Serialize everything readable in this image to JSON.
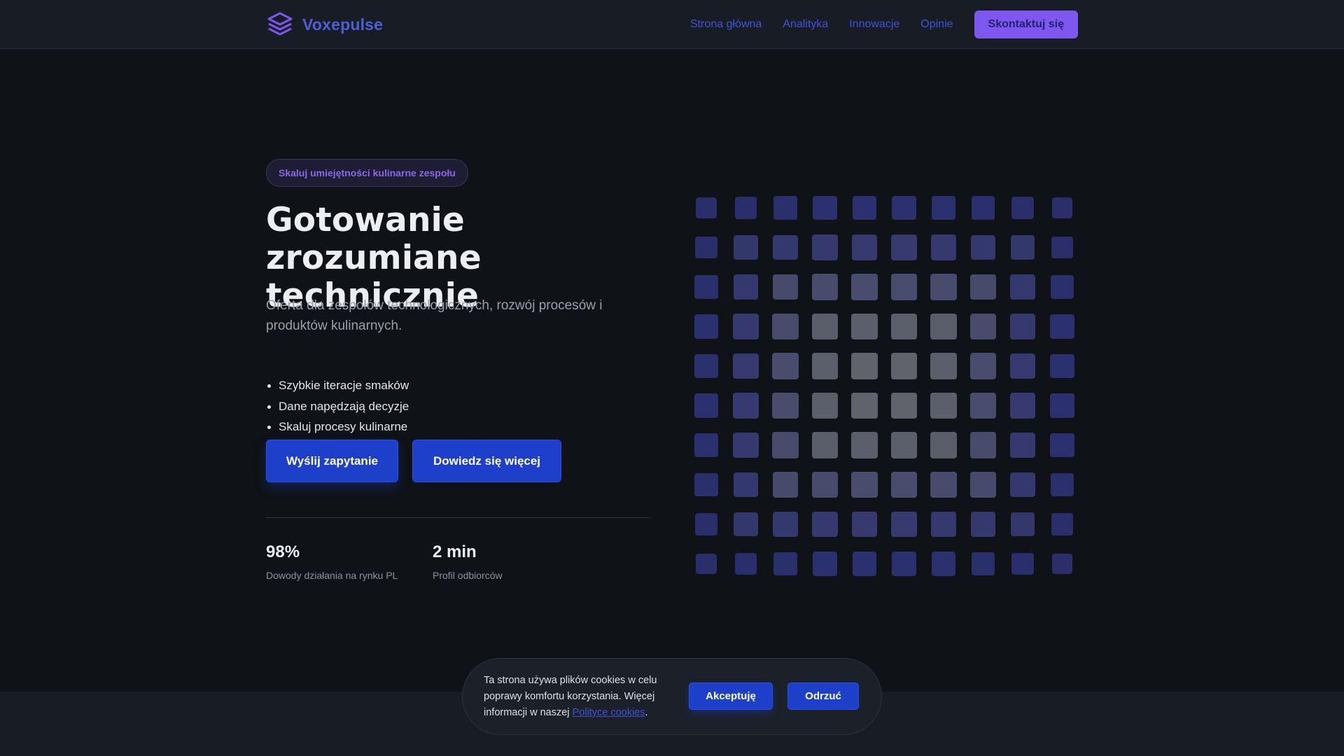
{
  "brand": {
    "name": "Voxepulse",
    "logo_icon": "layers-icon",
    "accent": "#4c5fd6"
  },
  "nav": {
    "items": [
      {
        "label": "Strona główna"
      },
      {
        "label": "Analityka"
      },
      {
        "label": "Innowacje"
      },
      {
        "label": "Opinie"
      }
    ],
    "cta_label": "Skontaktuj się"
  },
  "hero": {
    "badge": "Skaluj umiejętności kulinarne zespołu",
    "title": "Gotowanie zrozumiane technicznie",
    "subtitle": "Oferta dla zespołów technologicznych, rozwój procesów i produktów kulinarnych.",
    "features": [
      "Szybkie iteracje smaków",
      "Dane napędzają decyzje",
      "Skaluj procesy kulinarne"
    ],
    "primary_button": "Wyślij zapytanie",
    "secondary_button": "Dowiedz się więcej",
    "stats": [
      {
        "value": "98%",
        "label": "Dowody działania na rynku PL"
      },
      {
        "value": "2 min",
        "label": "Profil odbiorców"
      }
    ]
  },
  "cookie": {
    "text_before": "Ta strona używa plików cookies w celu poprawy komfortu korzystania. Więcej informacji w naszej ",
    "link_text": "Polityce cookies",
    "text_after": ".",
    "accept_label": "Akceptuję",
    "reject_label": "Odrzuć"
  },
  "colors": {
    "background": "#0f1216",
    "header": "#181c24",
    "primary": "#1d3fc9",
    "purple": "#7e57f0",
    "grid_blue": "#2f3479",
    "grid_gray": "#62656e"
  }
}
